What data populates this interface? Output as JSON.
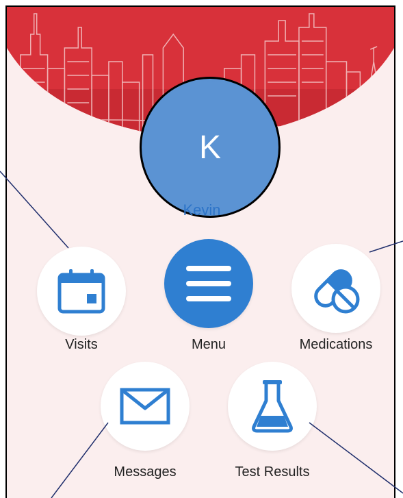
{
  "profile": {
    "initial": "K",
    "name": "Kevin"
  },
  "tiles": {
    "visits": {
      "label": "Visits",
      "icon": "calendar-icon"
    },
    "menu": {
      "label": "Menu",
      "icon": "hamburger-menu-icon"
    },
    "medications": {
      "label": "Medications",
      "icon": "pill-icon"
    },
    "messages": {
      "label": "Messages",
      "icon": "envelope-icon"
    },
    "test_results": {
      "label": "Test Results",
      "icon": "flask-icon"
    }
  },
  "colors": {
    "accent": "#2f7fd1",
    "avatar_bg": "#5b93d3",
    "banner_red": "#d8313a",
    "page_bg": "#fbeeee"
  }
}
